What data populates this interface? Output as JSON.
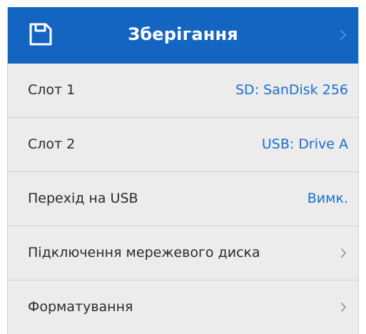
{
  "header": {
    "title": "Зберігання",
    "icon": "save-icon",
    "accent": "#1464c2"
  },
  "rows": [
    {
      "label": "Слот 1",
      "value": "SD: SanDisk 256"
    },
    {
      "label": "Слот 2",
      "value": "USB: Drive A"
    },
    {
      "label": "Перехід на USB",
      "value": "Вимк."
    },
    {
      "label": "Підключення мережевого диска",
      "icon": "chevron-right-icon"
    },
    {
      "label": "Форматування",
      "icon": "chevron-right-icon"
    }
  ],
  "colors": {
    "value_text": "#1a6fd0",
    "row_background": "#ececec"
  }
}
